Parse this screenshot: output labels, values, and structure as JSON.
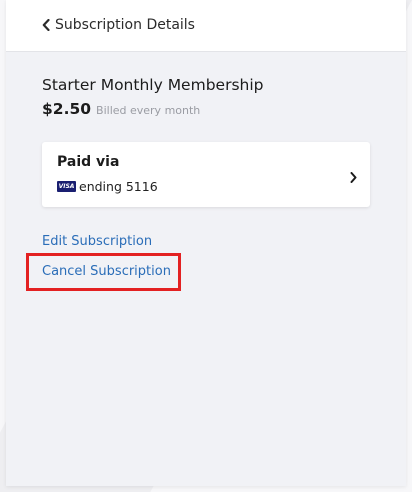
{
  "header": {
    "back_label": "Subscription Details"
  },
  "subscription": {
    "plan_name": "Starter Monthly Membership",
    "price": "$2.50",
    "billing": "Billed every month"
  },
  "payment": {
    "title": "Paid via",
    "card_brand": "VISA",
    "card_text": "ending 5116"
  },
  "actions": {
    "edit_label": "Edit Subscription",
    "cancel_label": "Cancel Subscription"
  },
  "colors": {
    "link": "#2a6db8",
    "highlight": "#e32122",
    "visa": "#1a1f71"
  }
}
